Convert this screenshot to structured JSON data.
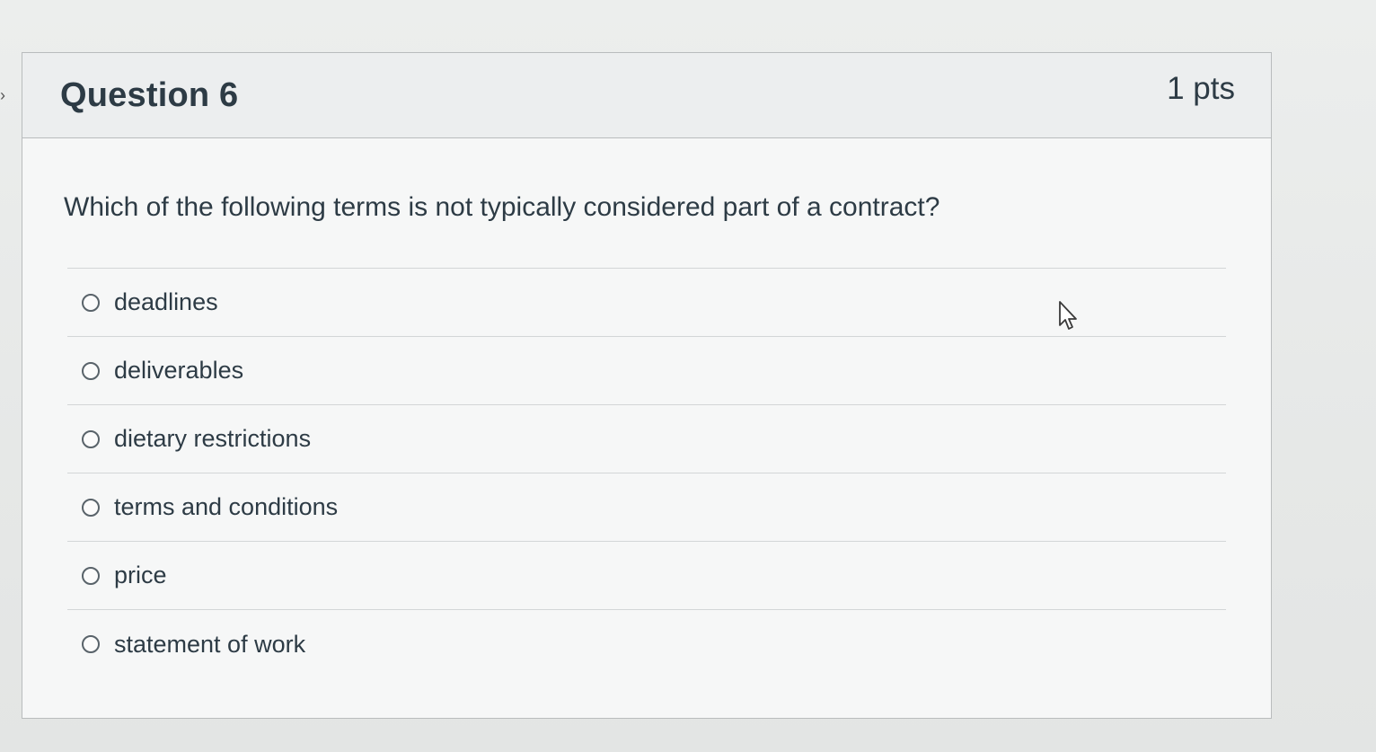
{
  "question": {
    "title": "Question 6",
    "points": "1 pts",
    "text": "Which of the following terms is not typically considered part of a contract?",
    "answers": [
      {
        "label": "deadlines"
      },
      {
        "label": "deliverables"
      },
      {
        "label": "dietary restrictions"
      },
      {
        "label": "terms and conditions"
      },
      {
        "label": "price"
      },
      {
        "label": "statement of work"
      }
    ]
  },
  "icons": {
    "cursor": "mouse-pointer-icon",
    "nav": "chevron-right-icon"
  }
}
